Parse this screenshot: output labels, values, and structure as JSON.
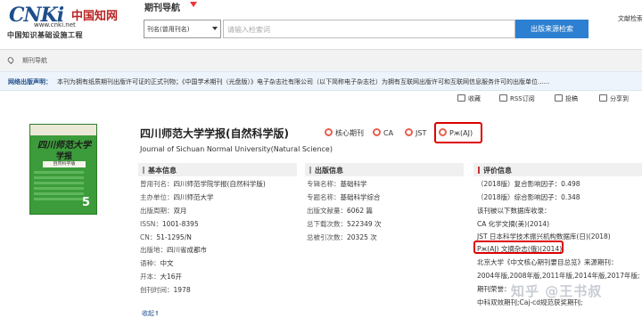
{
  "header": {
    "logo_main": "CNKi",
    "logo_cn": "中国知网",
    "logo_url": "www.cnki.net",
    "logo_sub": "中国知识基础设施工程",
    "nav_title": "期刊导航",
    "doc_link": "文献检索"
  },
  "search": {
    "select_value": "刊名(曾用刊名)",
    "placeholder": "请输入检索词",
    "button_label": "出版来源检索"
  },
  "breadcrumb": {
    "text": "期刊导航"
  },
  "notice": {
    "label": "网络出版声明：",
    "text": "本刊为拥有纸质期刊出版许可证的正式刊物；《中国学术期刊（光盘版）》电子杂志社有限公司（以下简称电子杂志社）为拥有互联网出版许可和互联网信息服务许可的出版单位......"
  },
  "actions": {
    "favorite": "收藏",
    "rss": "RSS订阅",
    "submit": "投稿",
    "share": "分享到"
  },
  "cover": {
    "title": "四川师范大学",
    "subtitle": "学报",
    "sub2": "自然科学版",
    "issue": "5"
  },
  "journal": {
    "title": "四川师范大学学报(自然科学版)",
    "title_en": "Journal of Sichuan Normal University(Natural Science)",
    "tags": [
      "核心期刊",
      "CA",
      "JST",
      "Рж(AJ)"
    ]
  },
  "basic": {
    "heading": "基本信息",
    "rows": [
      {
        "k": "曾用刊名：",
        "v": "四川师范学院学报(自然科学版)"
      },
      {
        "k": "主办单位：",
        "v": "四川师范大学"
      },
      {
        "k": "出版周期：",
        "v": "双月"
      },
      {
        "k": "ISSN：",
        "v": "1001-8395"
      },
      {
        "k": "CN：",
        "v": "51-1295/N"
      },
      {
        "k": "出版地：",
        "v": "四川省成都市"
      },
      {
        "k": "语种：",
        "v": "中文"
      },
      {
        "k": "开本：",
        "v": "大16开"
      },
      {
        "k": "创刊时间：",
        "v": "1978"
      }
    ],
    "collapse": "收起⇑"
  },
  "publish": {
    "heading": "出版信息",
    "rows": [
      {
        "k": "专辑名称：",
        "v": "基础科学"
      },
      {
        "k": "专题名称：",
        "v": "基础科学综合"
      },
      {
        "k": "出版文献量：",
        "v": "6062 篇"
      },
      {
        "k": "总下载次数：",
        "v": "522349 次"
      },
      {
        "k": "总被引次数：",
        "v": "20325 次"
      }
    ]
  },
  "evaluation": {
    "heading": "评价信息",
    "rows": [
      "（2018版）复合影响因子：0.498",
      "（2018版）综合影响因子：0.348",
      "该刊被以下数据库收录：",
      "CA 化学文摘(美)(2014)",
      "JST 日本科学技术振兴机构数据库(日)(2018)",
      "Рж(AJ) 文摘杂志(俄)(2014)",
      "北京大学《中文核心期刊要目总览》来源期刊：",
      "2004年版,2008年版,2011年版,2014年版,2017年版;",
      "期刊荣誉：",
      "中科双效期刊;Caj-cd规范获奖期刊;"
    ]
  },
  "watermark": "知乎 @王书叔"
}
